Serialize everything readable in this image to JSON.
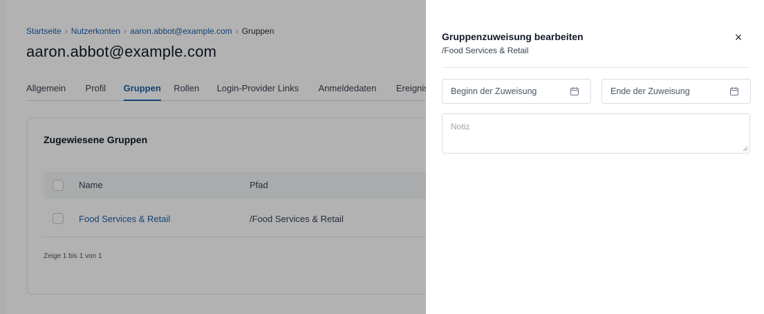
{
  "breadcrumb": {
    "items": [
      "Startseite",
      "Nutzerkonten",
      "aaron.abbot@example.com",
      "Gruppen"
    ],
    "separator": "›"
  },
  "page": {
    "title": "aaron.abbot@example.com"
  },
  "tabs": [
    {
      "label": "Allgemein",
      "active": false
    },
    {
      "label": "Profil",
      "active": false
    },
    {
      "label": "Gruppen",
      "active": true
    },
    {
      "label": "Rollen",
      "active": false
    },
    {
      "label": "Login-Provider Links",
      "active": false
    },
    {
      "label": "Anmeldedaten",
      "active": false
    },
    {
      "label": "Ereignisse",
      "active": false
    }
  ],
  "groups_card": {
    "title": "Zugewiesene Gruppen",
    "columns": {
      "name": "Name",
      "path": "Pfad"
    },
    "rows": [
      {
        "name": "Food Services & Retail",
        "path": "/Food Services & Retail"
      }
    ],
    "pager": "Zeige 1 bis 1 von 1"
  },
  "panel": {
    "title": "Gruppenzuweisung bearbeiten",
    "subtitle": "/Food Services & Retail",
    "close_label": "×",
    "start_placeholder": "Beginn der Zuweisung",
    "end_placeholder": "Ende der Zuweisung",
    "note_placeholder": "Notiz"
  },
  "colors": {
    "accent": "#1d5fa8",
    "overlay": "rgba(0,0,0,0.30)"
  },
  "icons": {
    "calendar": "calendar-icon",
    "close": "close-icon",
    "resize": "resize-handle-icon"
  }
}
